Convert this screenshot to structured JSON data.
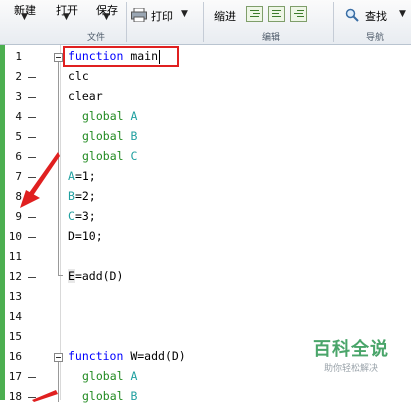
{
  "toolstrip": {
    "new_label": "新建",
    "open_label": "打开",
    "save_label": "保存",
    "print_label": "打印",
    "indent_label": "缩进",
    "find_label": "查找",
    "groups": {
      "file": "文件",
      "edit": "编辑",
      "nav": "导航"
    }
  },
  "editor": {
    "lines": [
      {
        "n": "1",
        "text": "function main"
      },
      {
        "n": "2",
        "text": "clc"
      },
      {
        "n": "3",
        "text": "clear"
      },
      {
        "n": "4",
        "text": "global A"
      },
      {
        "n": "5",
        "text": "global B"
      },
      {
        "n": "6",
        "text": "global C"
      },
      {
        "n": "7",
        "text": "A=1;"
      },
      {
        "n": "8",
        "text": "B=2;"
      },
      {
        "n": "9",
        "text": "C=3;"
      },
      {
        "n": "10",
        "text": "D=10;"
      },
      {
        "n": "11",
        "text": ""
      },
      {
        "n": "12",
        "text": "E=add(D)"
      },
      {
        "n": "13",
        "text": ""
      },
      {
        "n": "14",
        "text": ""
      },
      {
        "n": "15",
        "text": ""
      },
      {
        "n": "16",
        "text": "function W=add(D)"
      },
      {
        "n": "17",
        "text": "global A"
      },
      {
        "n": "18",
        "text": "global B"
      }
    ],
    "tokens": {
      "kw_function": "function",
      "main_name": "main",
      "kw_global": "global",
      "var_A": "A",
      "var_B": "B",
      "var_C": "C",
      "clc": "clc",
      "clear": "clear",
      "a_rest": "=1;",
      "b_rest": "=2;",
      "c_rest": "=3;",
      "d_line": "D=10;",
      "e_var": "E",
      "e_rest": "=add(D)",
      "add_sig": "W=add(D)"
    }
  },
  "watermark": {
    "main": "百科全说",
    "sub": "助你轻松解决"
  },
  "colors": {
    "keyword": "#0000ff",
    "global": "#228b22",
    "variable": "#20a0a0",
    "annotation_red": "#e02020"
  }
}
